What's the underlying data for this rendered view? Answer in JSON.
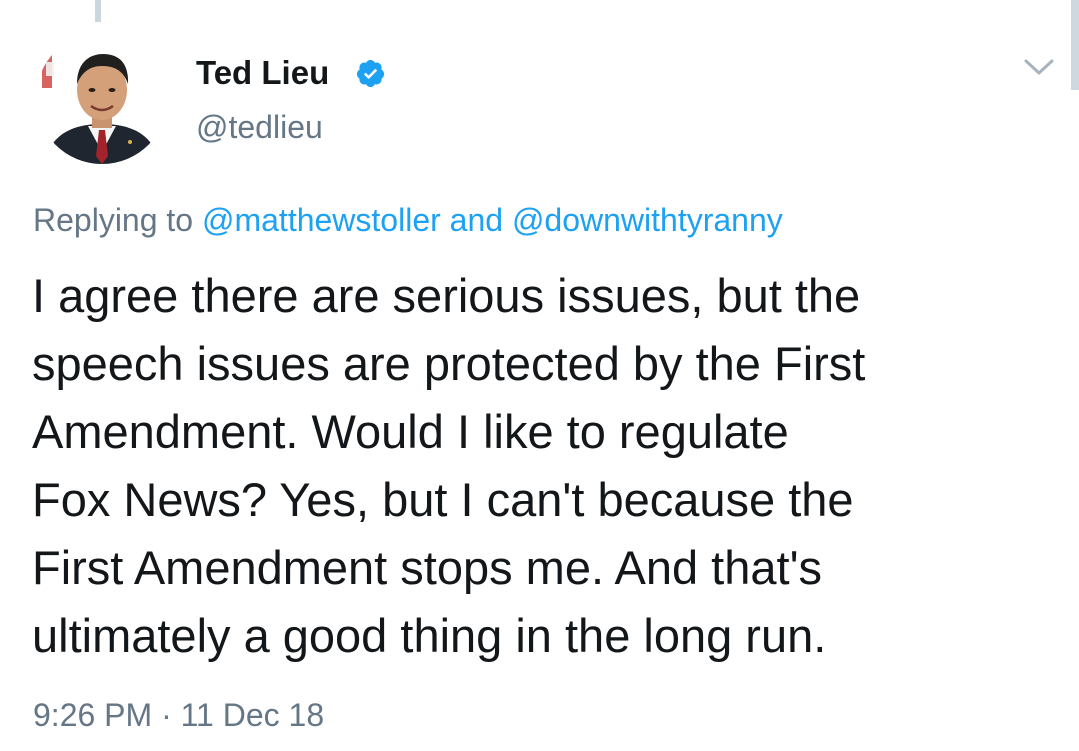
{
  "author": {
    "name": "Ted Lieu",
    "handle": "@tedlieu",
    "verified": true
  },
  "reply": {
    "prefix": "Replying to",
    "users": [
      "@matthewstoller",
      "@downwithtyranny"
    ],
    "joiner": "and"
  },
  "tweet": {
    "lines": [
      "I agree there are serious issues, but the",
      "speech issues are protected by the First",
      "Amendment. Would I like to regulate",
      "Fox News? Yes, but I can't because the",
      "First Amendment stops me. And that's",
      "ultimately a good thing in the long run."
    ]
  },
  "meta": {
    "time": "9:26 PM",
    "separator": "·",
    "date": "11 Dec 18"
  },
  "icons": {
    "verified": "verified-badge-icon",
    "menu": "chevron-down-icon"
  },
  "colors": {
    "link": "#1da1f2",
    "muted": "#657786",
    "text": "#14171a"
  }
}
